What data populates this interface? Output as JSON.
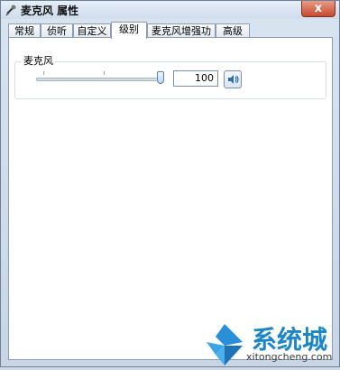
{
  "window": {
    "title": "麦克风 属性",
    "close_label": "x"
  },
  "tabs": [
    {
      "label": "常规"
    },
    {
      "label": "侦听"
    },
    {
      "label": "自定义"
    },
    {
      "label": "级别",
      "active": true
    },
    {
      "label": "麦克风增强功能"
    },
    {
      "label": "高级"
    }
  ],
  "levels": {
    "group_label": "麦克风",
    "slider_fraction": 1.0,
    "value": "100",
    "speaker_icon": "speaker-icon"
  },
  "watermark": {
    "brand": "系统城",
    "site": "xitongcheng.com"
  }
}
